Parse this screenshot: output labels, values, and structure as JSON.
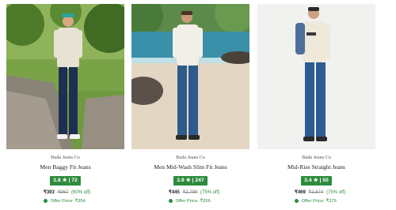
{
  "products": [
    {
      "brand": "Buda Jeans Co",
      "title": "Men Baggy Fit Jeans",
      "rating": "3.8",
      "star": "★",
      "reviews": "72",
      "price": "₹393",
      "mrp": "₹967",
      "discount": "(60% off)",
      "offer": "Offer Price: ₹354",
      "image_icon": "product-photo-park-icon"
    },
    {
      "brand": "Buda Jeans Co",
      "title": "Men Mid-Wash Slim Fit Jeans",
      "rating": "3.9",
      "star": "★",
      "reviews": "247",
      "price": "₹445",
      "mrp": "₹1,799",
      "discount": "(75% off)",
      "offer": "Offer Price: ₹356",
      "image_icon": "product-photo-beach-icon"
    },
    {
      "brand": "Buda Jeans Co",
      "title": "Mid-Rise Straight Jeans",
      "rating": "3.4",
      "star": "★",
      "reviews": "50",
      "price": "₹469",
      "mrp": "₹1,874",
      "discount": "(75% off)",
      "offer": "Offer Price: ₹375",
      "image_icon": "product-photo-studio-icon"
    }
  ],
  "colors": {
    "rating_badge": "#2e8b3e",
    "offer_text": "#2e8b3e",
    "denim": "#2d4f7c"
  }
}
